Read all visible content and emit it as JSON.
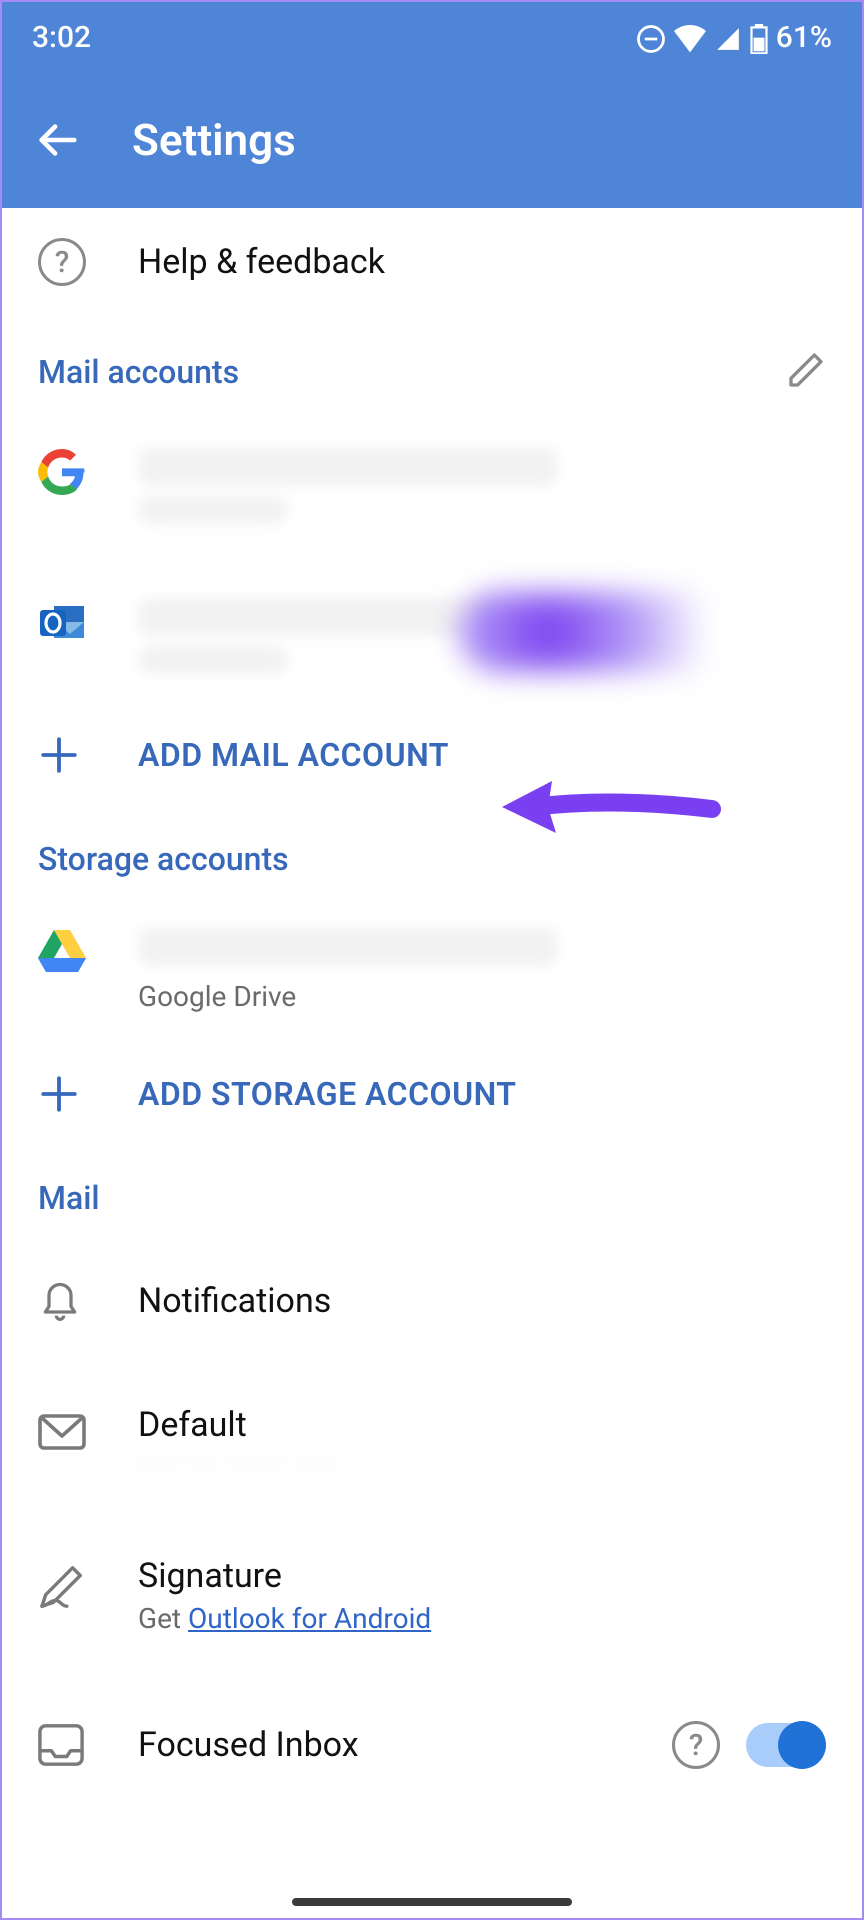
{
  "statusbar": {
    "time": "3:02",
    "battery": "61%"
  },
  "appbar": {
    "title": "Settings"
  },
  "help": {
    "label": "Help & feedback"
  },
  "sections": {
    "mail_accounts": {
      "header": "Mail accounts"
    },
    "storage_accounts": {
      "header": "Storage accounts"
    },
    "mail": {
      "header": "Mail"
    }
  },
  "actions": {
    "add_mail": "ADD MAIL ACCOUNT",
    "add_storage": "ADD STORAGE ACCOUNT"
  },
  "storage": {
    "drive_label": "Google Drive"
  },
  "mail_settings": {
    "notifications": "Notifications",
    "default": "Default",
    "signature": {
      "title": "Signature",
      "prefix": "Get ",
      "link": "Outlook for Android"
    },
    "focused": "Focused Inbox"
  }
}
